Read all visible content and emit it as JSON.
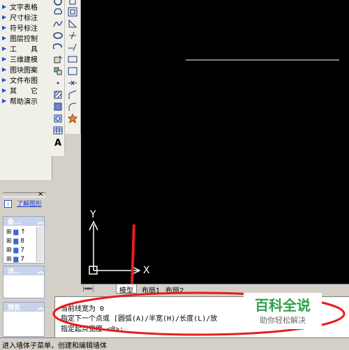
{
  "left_menu": {
    "items": [
      {
        "label": "文字表格"
      },
      {
        "label": "尺寸标注"
      },
      {
        "label": "符号标注"
      },
      {
        "label": "图层控制"
      },
      {
        "label": "工　　具"
      },
      {
        "label": "三维建模"
      },
      {
        "label": "图块图案"
      },
      {
        "label": "文件布图"
      },
      {
        "label": "其　　它"
      },
      {
        "label": "帮助演示"
      }
    ]
  },
  "help_panel": {
    "close": "×",
    "link_text": "了解图形"
  },
  "panel1": {
    "title": "备...",
    "rows": [
      "↑",
      "8",
      "7",
      "7"
    ]
  },
  "panel2": {
    "title": "详..."
  },
  "panel3": {
    "title": "预览"
  },
  "tabs": {
    "model": "模型",
    "layout1": "布局1",
    "layout2": "布局2"
  },
  "command": {
    "line1": "当前线宽为 0",
    "line2": "指定下一个点或 [圆弧(A)/半宽(H)/长度(L)/放",
    "line3": "指定起点宽度 <0>:"
  },
  "watermark": {
    "title": "百科全说",
    "subtitle": "助你轻松解决"
  },
  "status": {
    "text": "进入墙体子菜单，创建和编辑墙体"
  },
  "ucs": {
    "x_label": "X",
    "y_label": "Y"
  },
  "tools_col2": [
    "A"
  ]
}
